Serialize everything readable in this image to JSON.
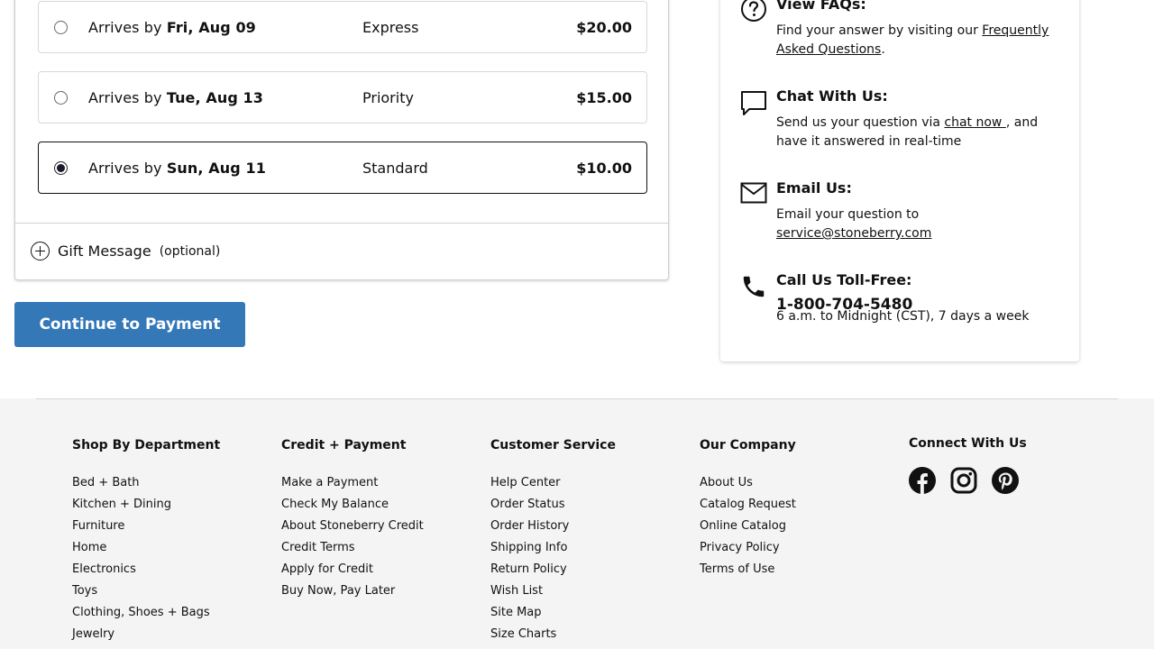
{
  "shipping": {
    "options": [
      {
        "arrives_prefix": "Arrives by ",
        "date": "Fri, Aug 09",
        "service": "Express",
        "price": "$20.00",
        "selected": false
      },
      {
        "arrives_prefix": "Arrives by ",
        "date": "Tue, Aug 13",
        "service": "Priority",
        "price": "$15.00",
        "selected": false
      },
      {
        "arrives_prefix": "Arrives by ",
        "date": "Sun, Aug 11",
        "service": "Standard",
        "price": "$10.00",
        "selected": true
      }
    ],
    "gift_label": "Gift Message",
    "gift_optional": "(optional)"
  },
  "continue_label": "Continue to Payment",
  "help": {
    "faq": {
      "title": "View FAQs:",
      "text_prefix": "Find your answer by visiting our ",
      "link": "Frequently Asked Questions",
      "text_suffix": "."
    },
    "chat": {
      "title": "Chat With Us:",
      "text_prefix": "Send us your question via ",
      "link": "chat now ",
      "text_suffix": ", and have it answered in real-time"
    },
    "email": {
      "title": "Email Us:",
      "text_prefix": "Email your question to",
      "link": "service@stoneberry.com"
    },
    "phone": {
      "title": "Call Us Toll-Free:",
      "number": "1-800-704-5480",
      "hours": "6 a.m. to Midnight (CST), 7 days a week"
    }
  },
  "footer": {
    "columns": [
      {
        "title": "Shop By Department",
        "links": [
          "Bed + Bath",
          "Kitchen + Dining",
          "Furniture",
          "Home",
          "Electronics",
          "Toys",
          "Clothing, Shoes + Bags",
          "Jewelry"
        ]
      },
      {
        "title": "Credit + Payment",
        "links": [
          "Make a Payment",
          "Check My Balance",
          "About Stoneberry Credit",
          "Credit Terms",
          "Apply for Credit",
          "Buy Now, Pay Later"
        ]
      },
      {
        "title": "Customer Service",
        "links": [
          "Help Center",
          "Order Status",
          "Order History",
          "Shipping Info",
          "Return Policy",
          "Wish List",
          "Site Map",
          "Size Charts"
        ]
      },
      {
        "title": "Our Company",
        "links": [
          "About Us",
          "Catalog Request",
          "Online Catalog",
          "Privacy Policy",
          "Terms of Use"
        ]
      }
    ],
    "connect_title": "Connect With Us",
    "social_icons": [
      "facebook-icon",
      "instagram-icon",
      "pinterest-icon"
    ]
  },
  "colors": {
    "accent": "#3478b8",
    "footer_bg": "#f4f4f4"
  }
}
